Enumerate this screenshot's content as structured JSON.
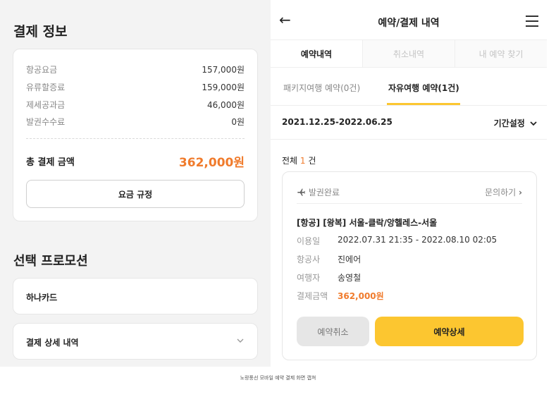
{
  "left": {
    "section_title": "결제 정보",
    "fees": [
      {
        "label": "항공요금",
        "value": "157,000원"
      },
      {
        "label": "유류할증료",
        "value": "159,000원"
      },
      {
        "label": "제세공과금",
        "value": "46,000원"
      },
      {
        "label": "발권수수료",
        "value": "0원"
      }
    ],
    "total_label": "총 결제 금액",
    "total_value": "362,000원",
    "rules_button": "요금 규정",
    "promo_title": "선택 프로모션",
    "promo_item": "하나카드",
    "detail_label": "결제 상세 내역"
  },
  "right": {
    "back_icon": "←",
    "title": "예약/결제 내역",
    "tabs": [
      "예약내역",
      "취소내역",
      "내 예약 찾기"
    ],
    "subtabs": [
      "패키지여행 예약(0건)",
      "자유여행 예약(1건)"
    ],
    "period": "2021.12.25-2022.06.25",
    "period_setting": "기간설정",
    "count_prefix": "전체",
    "count_number": "1",
    "count_suffix": "건",
    "card": {
      "status": "발권완료",
      "inquiry": "문의하기",
      "title": "[항공] [왕복] 서울-클락/앙헬레스-서울",
      "rows": [
        {
          "key": "이용일",
          "value": "2022.07.31 21:35 - 2022.08.10 02:05"
        },
        {
          "key": "항공사",
          "value": "진에어"
        },
        {
          "key": "여행자",
          "value": "송영철"
        },
        {
          "key": "결제금액",
          "value": "362,000원"
        }
      ],
      "cancel_button": "예약취소",
      "detail_button": "예약상세"
    }
  },
  "caption": "노랑풍선 모바일 예약 결제 화면 캡쳐",
  "colors": {
    "accent": "#fcc630",
    "price": "#f07b2c"
  }
}
